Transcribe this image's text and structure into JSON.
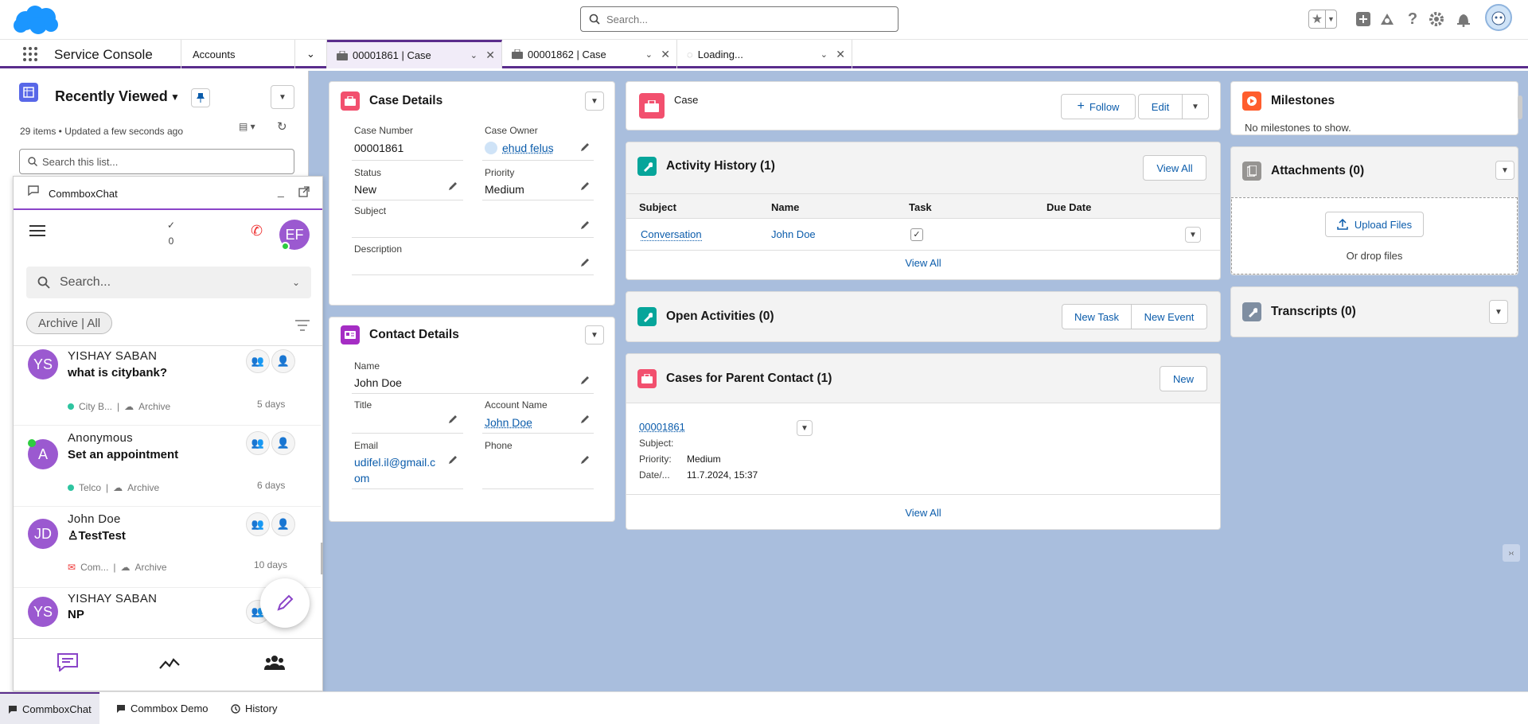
{
  "header": {
    "search_placeholder": "Search..."
  },
  "nav": {
    "app_name": "Service Console",
    "object_tab": "Accounts",
    "tabs": [
      {
        "label": "00001861 | Case"
      },
      {
        "label": "00001862 | Case"
      },
      {
        "label": "Loading..."
      }
    ]
  },
  "list_view": {
    "title": "Recently Viewed",
    "meta": "29 items • Updated a few seconds ago",
    "search_placeholder": "Search this list..."
  },
  "chat": {
    "title": "CommboxChat",
    "count": "0",
    "agent_initials": "EF",
    "search_placeholder": "Search...",
    "filter_label": "Archive | All",
    "conversations": [
      {
        "initials": "YS",
        "name": "YISHAY SABAN",
        "message": "what is citybank?",
        "channel": "City B...",
        "status": "Archive",
        "time": "5 days"
      },
      {
        "initials": "A",
        "name": "Anonymous",
        "message": "Set an appointment",
        "channel": "Telco",
        "status": "Archive",
        "time": "6 days"
      },
      {
        "initials": "JD",
        "name": "John Doe",
        "message": "TestTest",
        "channel": "Com...",
        "status": "Archive",
        "time": "10 days"
      },
      {
        "initials": "YS",
        "name": "YISHAY SABAN",
        "message": "NP",
        "channel": "",
        "status": "",
        "time": ""
      }
    ]
  },
  "case_details": {
    "title": "Case Details",
    "case_number_label": "Case Number",
    "case_number": "00001861",
    "case_owner_label": "Case Owner",
    "case_owner": "ehud felus",
    "status_label": "Status",
    "status": "New",
    "priority_label": "Priority",
    "priority": "Medium",
    "subject_label": "Subject",
    "description_label": "Description"
  },
  "contact_details": {
    "title": "Contact Details",
    "name_label": "Name",
    "name": "John Doe",
    "title_label": "Title",
    "account_label": "Account Name",
    "account": "John Doe",
    "email_label": "Email",
    "email_line1": "udifel.il@gmail.c",
    "email_line2": "om",
    "phone_label": "Phone"
  },
  "case_header": {
    "label": "Case",
    "follow": "Follow",
    "edit": "Edit"
  },
  "activity_history": {
    "title": "Activity History (1)",
    "view_all": "View All",
    "columns": [
      "Subject",
      "Name",
      "Task",
      "Due Date"
    ],
    "row": {
      "subject": "Conversation",
      "name": "John Doe"
    },
    "footer_view_all": "View All"
  },
  "open_activities": {
    "title": "Open Activities (0)",
    "new_task": "New Task",
    "new_event": "New Event"
  },
  "cases_parent": {
    "title": "Cases for Parent Contact (1)",
    "new": "New",
    "case_link": "00001861",
    "subject_label": "Subject:",
    "priority_label": "Priority:",
    "priority": "Medium",
    "date_label": "Date/...",
    "date": "11.7.2024, 15:37",
    "view_all": "View All"
  },
  "milestones": {
    "title": "Milestones",
    "empty": "No milestones to show."
  },
  "attachments": {
    "title": "Attachments (0)",
    "upload": "Upload Files",
    "drop": "Or drop files"
  },
  "transcripts": {
    "title": "Transcripts (0)"
  },
  "bottom": {
    "tabs": [
      "CommboxChat",
      "Commbox Demo",
      "History"
    ]
  },
  "colors": {
    "brand": "#1b96ff",
    "nav_accent": "#5a2d8c",
    "case_icon": "#f2506e",
    "activity_icon": "#06a59a",
    "chat_accent": "#8a44c8",
    "milestone_icon": "#ff5d2d"
  }
}
